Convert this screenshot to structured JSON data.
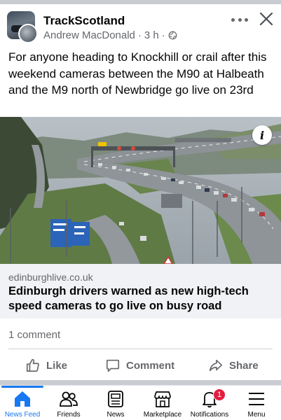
{
  "post": {
    "page_name": "TrackScotland",
    "author": "Andrew MacDonald",
    "time": "3 h",
    "separator": "·",
    "text": "For anyone heading to Knockhill or crail after this weekend cameras between the M90 at Halbeath and the M9 north of Newbridge go live on 23rd"
  },
  "link": {
    "domain": "edinburghlive.co.uk",
    "title": "Edinburgh drivers warned as new high-tech speed cameras to go live on busy road",
    "info_symbol": "i"
  },
  "engagement": {
    "comment_count": "1 comment"
  },
  "actions": {
    "like": "Like",
    "comment": "Comment",
    "share": "Share"
  },
  "nav": {
    "news_feed": "News Feed",
    "friends": "Friends",
    "news": "News",
    "marketplace": "Marketplace",
    "notifications": "Notifications",
    "notifications_badge": "1",
    "menu": "Menu"
  },
  "colors": {
    "accent": "#1877f2",
    "badge": "#e41e3f",
    "secondary_text": "#65676b",
    "link_bg": "#f0f2f5"
  },
  "icons": [
    "globe-icon",
    "more-icon",
    "close-icon",
    "info-icon",
    "like-icon",
    "comment-icon",
    "share-icon",
    "home-icon",
    "friends-icon",
    "news-icon",
    "marketplace-icon",
    "bell-icon",
    "menu-icon"
  ]
}
